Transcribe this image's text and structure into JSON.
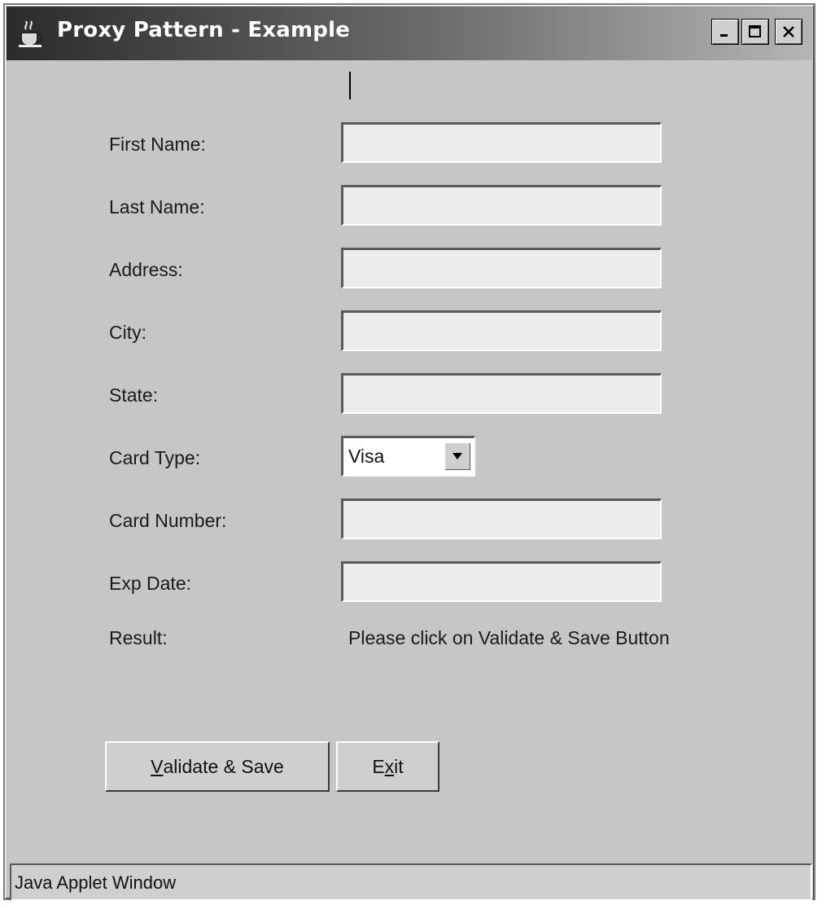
{
  "window": {
    "title": "Proxy Pattern - Example",
    "icon": "java-coffee-cup-icon",
    "controls": [
      "minimize",
      "maximize",
      "close"
    ]
  },
  "form": {
    "fields": [
      {
        "label": "First Name:",
        "value": "",
        "focused": true
      },
      {
        "label": "Last Name:",
        "value": ""
      },
      {
        "label": "Address:",
        "value": ""
      },
      {
        "label": "City:",
        "value": ""
      },
      {
        "label": "State:",
        "value": ""
      }
    ],
    "card_type": {
      "label": "Card Type:",
      "selected": "Visa"
    },
    "card_fields": [
      {
        "label": "Card Number:",
        "value": ""
      },
      {
        "label": "Exp Date:",
        "value": ""
      }
    ],
    "result": {
      "label": "Result:",
      "text": "Please click on Validate & Save Button"
    }
  },
  "buttons": {
    "validate": {
      "mnemonic": "V",
      "rest": "alidate & Save"
    },
    "exit": {
      "pre": "E",
      "mnemonic": "x",
      "post": "it"
    }
  },
  "status": {
    "text": "Java Applet Window"
  }
}
